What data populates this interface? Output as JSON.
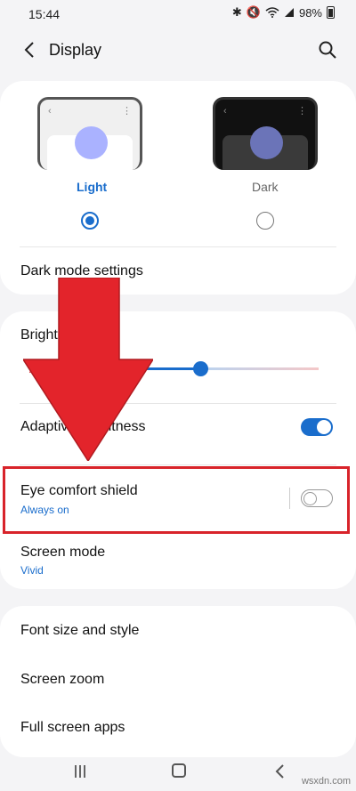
{
  "status_bar": {
    "time": "15:44",
    "battery": "98%"
  },
  "header": {
    "title": "Display"
  },
  "themes": {
    "light_label": "Light",
    "dark_label": "Dark",
    "selected": "light"
  },
  "dark_mode_settings": "Dark mode settings",
  "brightness": {
    "label": "Brightness",
    "level": 0.58
  },
  "adaptive_brightness": {
    "label": "Adaptive brightness",
    "enabled": true
  },
  "eye_comfort": {
    "label": "Eye comfort shield",
    "sub": "Always on",
    "enabled": false
  },
  "screen_mode": {
    "label": "Screen mode",
    "sub": "Vivid"
  },
  "list": {
    "font_size": "Font size and style",
    "screen_zoom": "Screen zoom",
    "full_screen_apps": "Full screen apps"
  },
  "watermark": "wsxdn.com",
  "colors": {
    "accent": "#1a6dcc",
    "highlight": "#d8232a"
  }
}
